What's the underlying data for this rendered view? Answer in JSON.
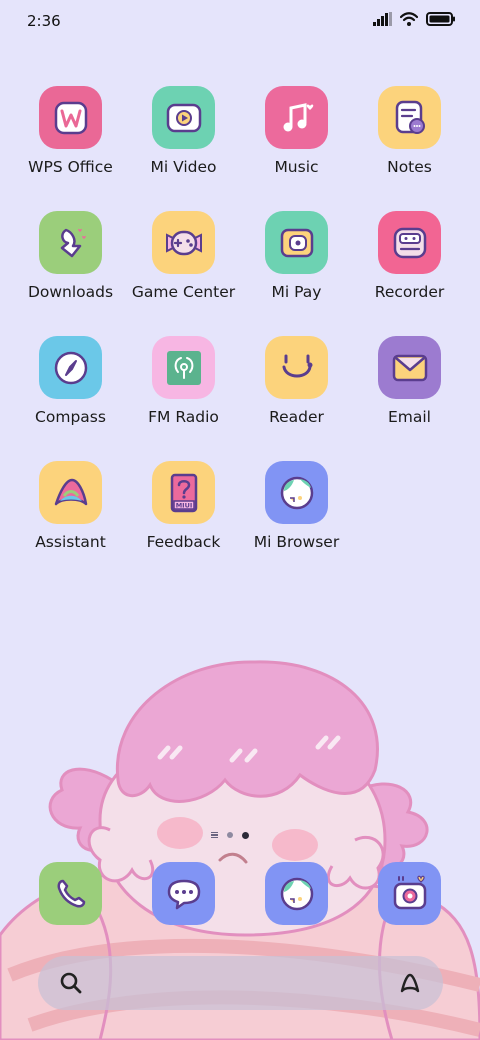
{
  "status_bar": {
    "time": "2:36",
    "icons": [
      "signal-icon",
      "wifi-icon",
      "battery-icon"
    ]
  },
  "apps": [
    {
      "id": "wps-office",
      "label": "WPS Office",
      "icon": "wps-office-icon",
      "color": "#ea6896"
    },
    {
      "id": "mi-video",
      "label": "Mi Video",
      "icon": "video-play-icon",
      "color": "#6dd2b2"
    },
    {
      "id": "music",
      "label": "Music",
      "icon": "music-note-icon",
      "color": "#ec6a9c"
    },
    {
      "id": "notes",
      "label": "Notes",
      "icon": "notes-icon",
      "color": "#fcd37c"
    },
    {
      "id": "downloads",
      "label": "Downloads",
      "icon": "download-icon",
      "color": "#9bce7b"
    },
    {
      "id": "game-center",
      "label": "Game Center",
      "icon": "gamepad-icon",
      "color": "#fcd37c"
    },
    {
      "id": "mi-pay",
      "label": "Mi Pay",
      "icon": "wallet-icon",
      "color": "#6dd2b2"
    },
    {
      "id": "recorder",
      "label": "Recorder",
      "icon": "recorder-icon",
      "color": "#f26593"
    },
    {
      "id": "compass",
      "label": "Compass",
      "icon": "compass-icon",
      "color": "#6bc8e8"
    },
    {
      "id": "fm-radio",
      "label": "FM Radio",
      "icon": "radio-icon",
      "color": "#f7b6e3"
    },
    {
      "id": "reader",
      "label": "Reader",
      "icon": "reader-icon",
      "color": "#fcd37c"
    },
    {
      "id": "email",
      "label": "Email",
      "icon": "envelope-icon",
      "color": "#9c7bd0"
    },
    {
      "id": "assistant",
      "label": "Assistant",
      "icon": "assistant-icon",
      "color": "#fcd37c"
    },
    {
      "id": "feedback",
      "label": "Feedback",
      "icon": "feedback-icon",
      "color": "#fcd37c"
    },
    {
      "id": "mi-browser",
      "label": "Mi Browser",
      "icon": "globe-icon",
      "color": "#8194f4"
    }
  ],
  "feedback_badge": "MIUI",
  "page_indicator": {
    "pages": 2,
    "active": 2
  },
  "dock": [
    {
      "id": "phone",
      "icon": "phone-icon",
      "color": "#9bce7b"
    },
    {
      "id": "messaging",
      "icon": "chat-bubble-icon",
      "color": "#8194f4"
    },
    {
      "id": "browser",
      "icon": "globe-icon",
      "color": "#8194f4"
    },
    {
      "id": "camera",
      "icon": "camera-icon",
      "color": "#8194f4"
    }
  ],
  "search_bar": {
    "left_icon": "search-icon",
    "right_icon": "assistant-icon"
  },
  "colors": {
    "background": "#e5e4fb",
    "wallpaper_hair": "#eba7d4",
    "wallpaper_outline": "#e28fbf",
    "wallpaper_face": "#f4dfe9",
    "icon_outline": "#5a3d8e"
  }
}
